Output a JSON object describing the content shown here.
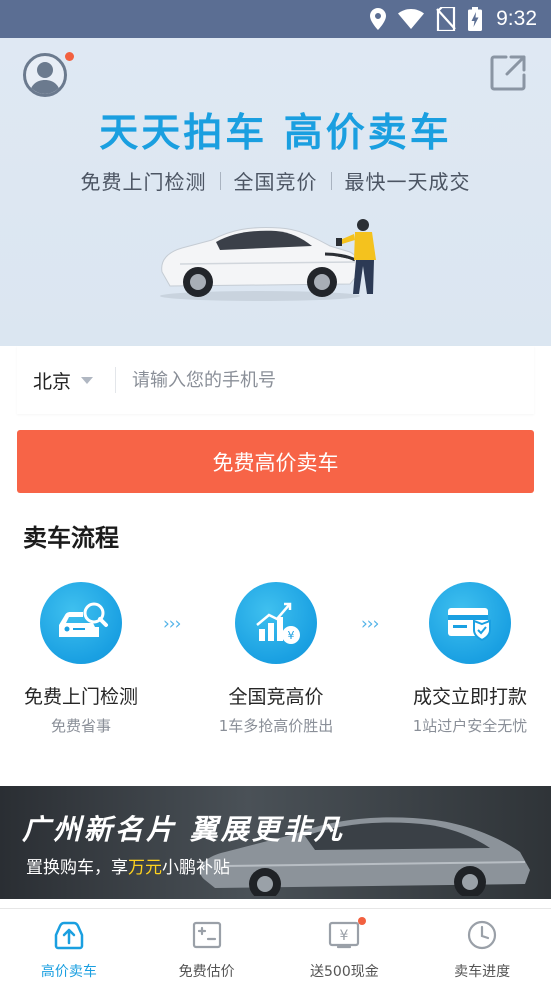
{
  "status_bar": {
    "time": "9:32"
  },
  "hero": {
    "title": "天天拍车 高价卖车",
    "features": [
      "免费上门检测",
      "全国竞价",
      "最快一天成交"
    ]
  },
  "form": {
    "city": "北京",
    "phone_placeholder": "请输入您的手机号",
    "submit_label": "免费高价卖车"
  },
  "process": {
    "title": "卖车流程",
    "arrow": "›››",
    "steps": [
      {
        "title": "免费上门检测",
        "subtitle": "免费省事",
        "icon": "car-inspection-icon"
      },
      {
        "title": "全国竞高价",
        "subtitle": "1车多抢高价胜出",
        "icon": "bidding-chart-icon"
      },
      {
        "title": "成交立即打款",
        "subtitle": "1站过户安全无忧",
        "icon": "payment-card-icon"
      }
    ]
  },
  "banner": {
    "title": "广州新名片 翼展更非凡",
    "sub_before": "置换购车，享",
    "sub_highlight": "万元",
    "sub_after": "小鹏补贴"
  },
  "bottom_nav": {
    "items": [
      {
        "label": "高价卖车",
        "icon": "sell-car-icon",
        "active": true
      },
      {
        "label": "免费估价",
        "icon": "valuation-icon",
        "active": false
      },
      {
        "label": "送500现金",
        "icon": "cash-gift-icon",
        "active": false
      },
      {
        "label": "卖车进度",
        "icon": "clock-icon",
        "active": false
      }
    ]
  },
  "colors": {
    "status_bar": "#5b6e93",
    "brand_blue": "#1a9fe0",
    "cta_orange": "#f76447",
    "notification_dot": "#f2603f",
    "banner_highlight": "#ffd21e"
  }
}
